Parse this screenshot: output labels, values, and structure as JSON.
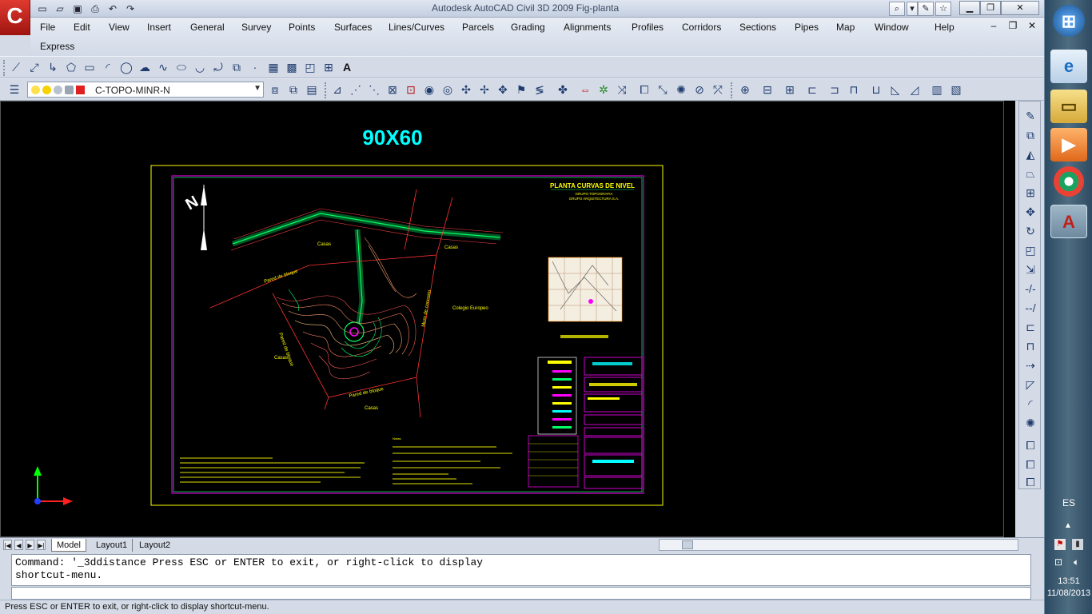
{
  "titlebar": {
    "title": "Autodesk AutoCAD Civil 3D 2009  Fig-planta",
    "app_letter": "C",
    "quick_access": [
      "new-icon",
      "open-icon",
      "save-icon",
      "print-icon",
      "undo-icon",
      "redo-icon"
    ],
    "infocenter": [
      "search-icon",
      "comm-center-icon",
      "favorites-icon"
    ],
    "window_controls": [
      "minimize-icon",
      "restore-icon",
      "close-icon"
    ]
  },
  "menu": {
    "items": [
      "File",
      "Edit",
      "View",
      "Insert",
      "General",
      "Survey",
      "Points",
      "Surfaces",
      "Lines/Curves",
      "Parcels",
      "Grading",
      "Alignments",
      "Profiles",
      "Corridors",
      "Sections",
      "Pipes",
      "Map",
      "Window",
      "Help"
    ],
    "second_row": [
      "Express"
    ]
  },
  "layer_toolbar": {
    "current_layer": "C-TOPO-MINR-N",
    "dropdown_icon": "chevron-down-icon"
  },
  "drawing": {
    "sheet_title": "90X60",
    "plan_title": "PLANTA CURVAS DE NIVEL",
    "plan_subtitle_1": "GRUPO TOPOGRAFIA",
    "plan_subtitle_2": "GRUPO ARQUITECTURA S.A.",
    "labels": {
      "wall_1": "Pared de bloque",
      "wall_2": "Pared de bloque",
      "wall_3": "Pared de bloque",
      "wall_concrete": "Muro de concreto",
      "school": "Colegio Europeo",
      "house_1": "Casas",
      "house_2": "Casas",
      "house_3": "Casas",
      "house_4": "Casas"
    },
    "note_heading": "Notas"
  },
  "tabs": {
    "model": "Model",
    "layout1": "Layout1",
    "layout2": "Layout2"
  },
  "command": {
    "line1": "Command: '_3ddistance Press ESC or ENTER to exit, or right-click to display",
    "line2": "shortcut-menu."
  },
  "status": {
    "text": "Press ESC or ENTER to exit, or right-click to display shortcut-menu."
  },
  "taskbar": {
    "apps": [
      "windows-start-icon",
      "internet-explorer-icon",
      "file-explorer-icon",
      "media-player-icon",
      "chrome-icon",
      "autocad-icon"
    ],
    "language": "ES",
    "time": "13:51",
    "date": "11/08/2013"
  },
  "colors": {
    "accent_red": "#c0201a",
    "drawing_bg": "#000000",
    "plan_green": "#00ff66",
    "plan_yellow": "#ffff00",
    "plan_magenta": "#ff00ff",
    "title_cyan": "#00ffff"
  }
}
